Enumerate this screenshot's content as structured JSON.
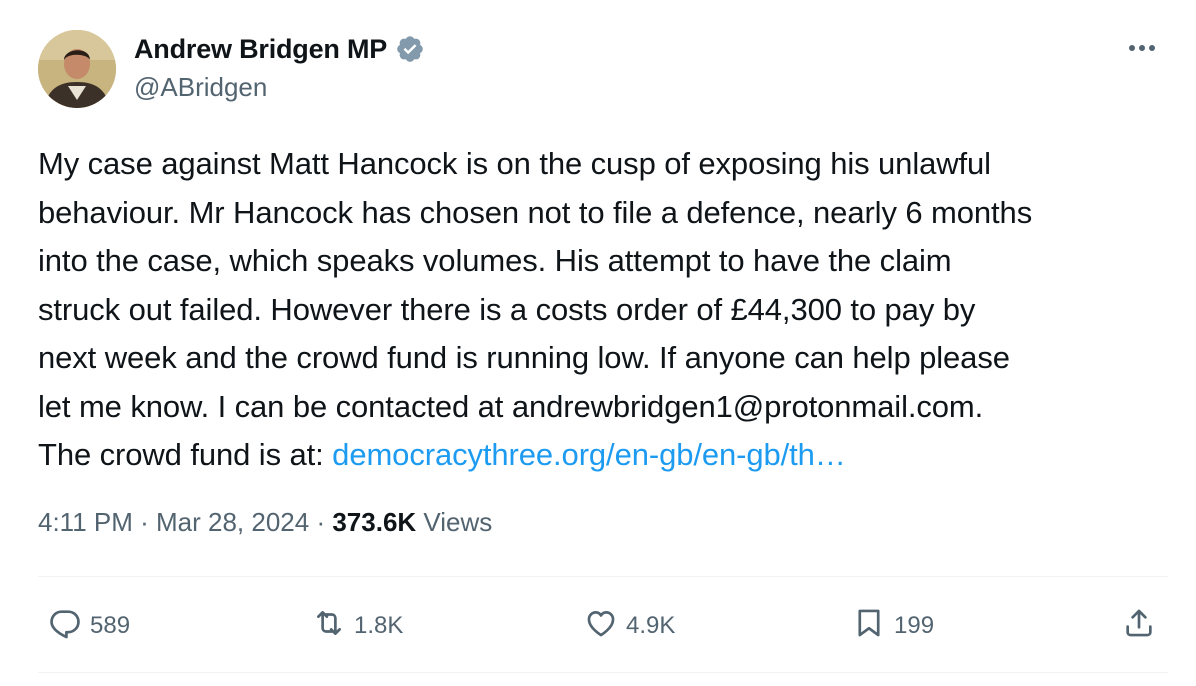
{
  "author": {
    "display_name": "Andrew Bridgen MP",
    "handle": "@ABridgen",
    "verified": true
  },
  "tweet": {
    "lines": [
      "My case against Matt Hancock is on the cusp of exposing his unlawful",
      "behaviour. Mr Hancock has chosen not to file a defence, nearly 6 months",
      "into the case, which speaks volumes. His attempt to have the claim",
      "struck out failed. However there is a costs order of £44,300 to pay by",
      "next week and the crowd fund is running low. If anyone can help please",
      "let me know. I can be contacted at andrewbridgen1@protonmail.com."
    ],
    "last_line_prefix": "The crowd fund is at: ",
    "link_text": "democracythree.org/en-gb/en-gb/th…"
  },
  "meta": {
    "time": "4:11 PM",
    "sep1": " · ",
    "date": "Mar 28, 2024",
    "sep2": " · ",
    "views_count": "373.6K",
    "views_label": " Views"
  },
  "actions": {
    "replies": "589",
    "reposts": "1.8K",
    "likes": "4.9K",
    "bookmarks": "199"
  },
  "colors": {
    "text": "#0f1419",
    "secondary": "#536471",
    "link": "#1d9bf0",
    "verified_badge": "#829aab",
    "divider": "#eff3f4"
  },
  "icons": {
    "more": "more-horizontal-icon",
    "reply": "reply-bubble-icon",
    "repost": "repost-arrows-icon",
    "like": "heart-icon",
    "bookmark": "bookmark-icon",
    "share": "share-upload-icon",
    "verified": "verified-badge-icon"
  }
}
